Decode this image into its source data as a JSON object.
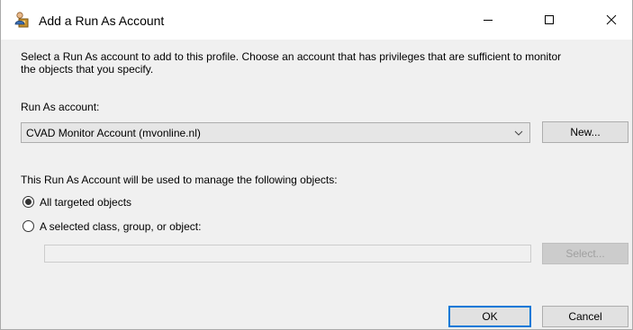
{
  "window": {
    "title": "Add a Run As Account",
    "icon": "run-as-account-icon"
  },
  "description": {
    "line1": "Select a Run As account to add to this profile.  Choose an account that has privileges that are sufficient to monitor",
    "line2": "the objects that you specify."
  },
  "run_as": {
    "label": "Run As account:",
    "selected": "CVAD Monitor Account (mvonline.nl)",
    "new_button": "New..."
  },
  "scope": {
    "label": "This Run As Account will be used to manage the following objects:",
    "options": [
      {
        "label": "All targeted objects",
        "selected": true
      },
      {
        "label": "A selected class, group, or object:",
        "selected": false
      }
    ],
    "object_value": "",
    "select_button": "Select..."
  },
  "buttons": {
    "ok": "OK",
    "cancel": "Cancel"
  },
  "colors": {
    "dialog_bg": "#f0f0f0",
    "accent": "#0078d7",
    "disabled_text": "#a0a0a0"
  }
}
